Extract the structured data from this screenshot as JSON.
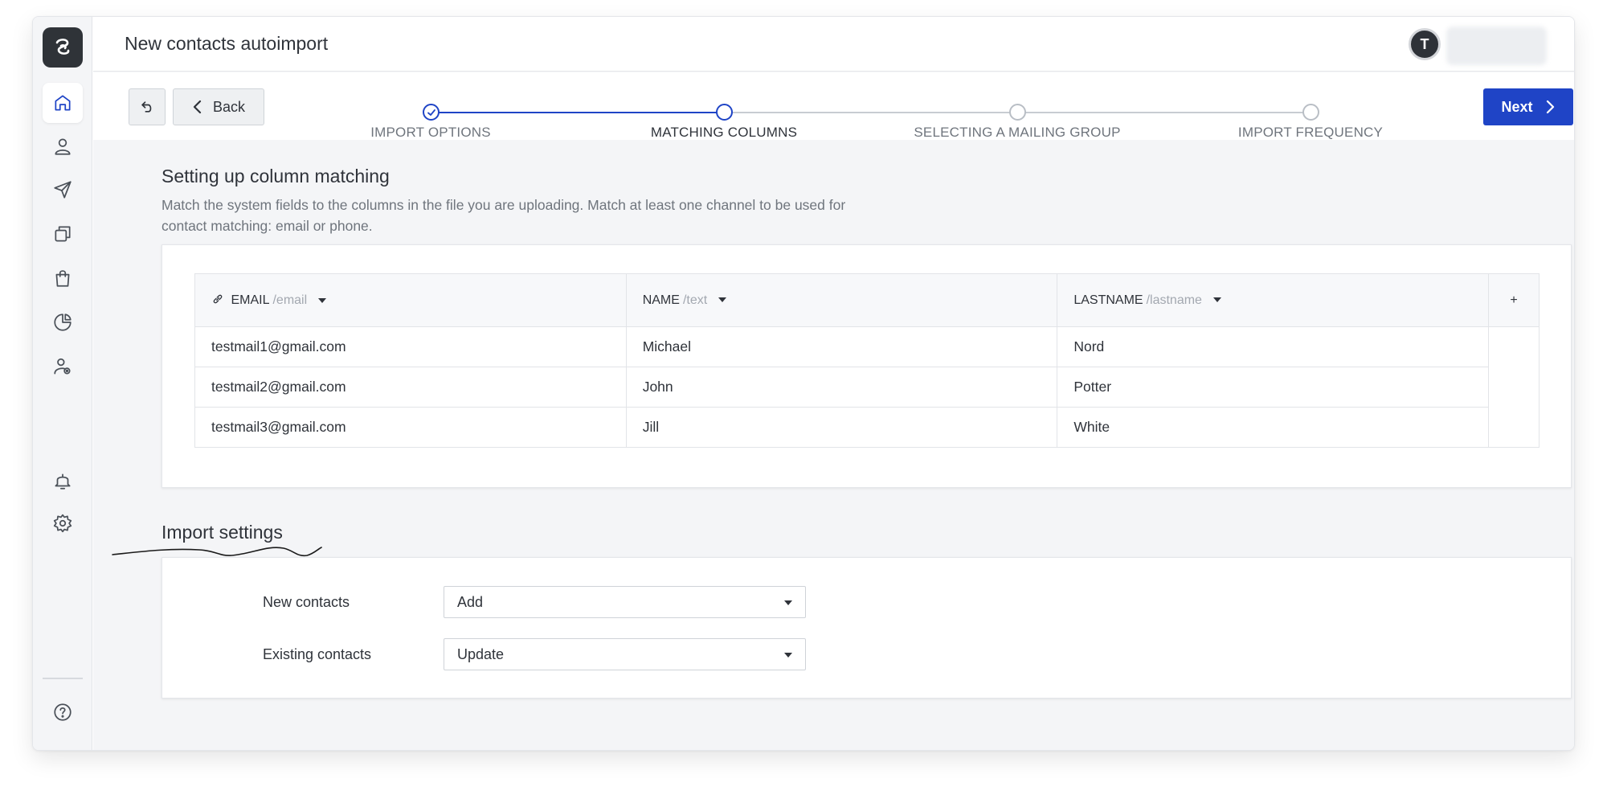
{
  "header": {
    "title": "New contacts autoimport",
    "avatar_initial": "T"
  },
  "toolbar": {
    "back_label": "Back",
    "next_label": "Next",
    "steps": [
      {
        "label": "IMPORT OPTIONS",
        "state": "done"
      },
      {
        "label": "MATCHING COLUMNS",
        "state": "current"
      },
      {
        "label": "SELECTING A MAILING GROUP",
        "state": "todo"
      },
      {
        "label": "IMPORT FREQUENCY",
        "state": "todo"
      }
    ]
  },
  "sidebar": {
    "items": [
      {
        "icon": "home-icon",
        "active": true
      },
      {
        "icon": "user-icon",
        "active": false
      },
      {
        "icon": "send-icon",
        "active": false
      },
      {
        "icon": "copy-icon",
        "active": false
      },
      {
        "icon": "shopping-bag-icon",
        "active": false
      },
      {
        "icon": "pie-chart-icon",
        "active": false
      },
      {
        "icon": "user-settings-icon",
        "active": false
      }
    ],
    "bottom": [
      "bell-icon",
      "gear-icon",
      "help-icon"
    ]
  },
  "matching": {
    "title": "Setting up column matching",
    "description": "Match the system fields to the columns in the file you are uploading. Match at least one channel to be used for contact matching: email or phone.",
    "columns": [
      {
        "name": "EMAIL",
        "type": "/email",
        "key": true
      },
      {
        "name": "NAME",
        "type": "/text",
        "key": false
      },
      {
        "name": "LASTNAME",
        "type": "/lastname",
        "key": false
      }
    ],
    "add_column_label": "+",
    "rows": [
      [
        "testmail1@gmail.com",
        "Michael",
        "Nord"
      ],
      [
        "testmail2@gmail.com",
        "John",
        "Potter"
      ],
      [
        "testmail3@gmail.com",
        "Jill",
        "White"
      ]
    ]
  },
  "settings": {
    "title": "Import settings",
    "new_contacts_label": "New contacts",
    "new_contacts_value": "Add",
    "existing_contacts_label": "Existing contacts",
    "existing_contacts_value": "Update"
  },
  "colors": {
    "accent": "#1f44c6",
    "sidebar_bg": "#f4f5f7",
    "logo_bg": "#2f3338"
  }
}
